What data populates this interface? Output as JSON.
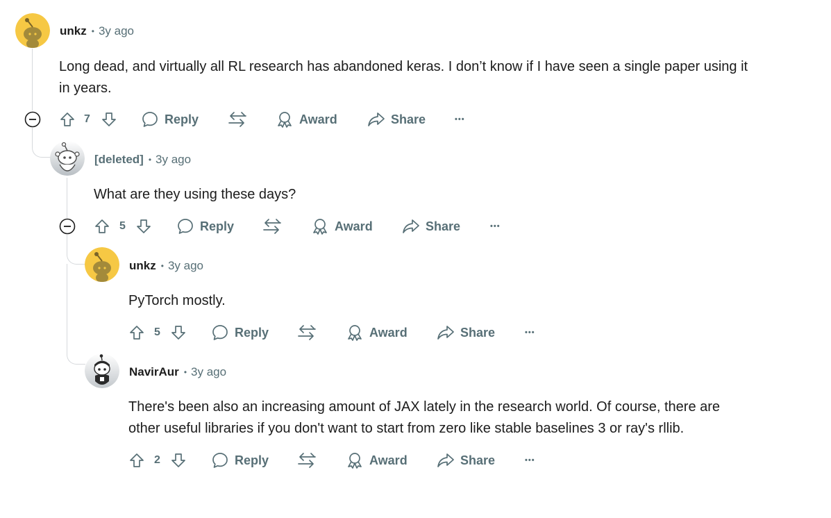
{
  "comments": [
    {
      "author": "unkz",
      "separator": "•",
      "time": "3y ago",
      "body_lines": [
        "Long dead, and virtually all RL research has abandoned keras. I don’t know if I have seen a single paper using it",
        "in years."
      ],
      "votes": "7",
      "avatar": "snoo-yellow"
    },
    {
      "author": "[deleted]",
      "separator": "•",
      "time": "3y ago",
      "body_lines": [
        "What are they using these days?"
      ],
      "votes": "5",
      "avatar": "snoo-deleted"
    },
    {
      "author": "unkz",
      "separator": "•",
      "time": "3y ago",
      "body_lines": [
        "PyTorch mostly."
      ],
      "votes": "5",
      "avatar": "snoo-yellow"
    },
    {
      "author": "NavirAur",
      "separator": "•",
      "time": "3y ago",
      "body_lines": [
        "There's been also an increasing amount of JAX lately in the research world. Of course, there are",
        "other useful libraries if you don't want to start from zero like stable baselines 3 or ray's rllib."
      ],
      "votes": "2",
      "avatar": "snoo-custom"
    }
  ],
  "actions": {
    "reply": "Reply",
    "award": "Award",
    "share": "Share",
    "more": "•••"
  },
  "icons": [
    "collapse-icon",
    "upvote-icon",
    "downvote-icon",
    "reply-icon",
    "crosspost-icon",
    "award-icon",
    "share-icon",
    "more-icon"
  ],
  "colors": {
    "meta": "#576f76",
    "thread_line": "#d6d9dc",
    "text": "#1c1c1c",
    "avatar_yellow": "#f6c844"
  }
}
